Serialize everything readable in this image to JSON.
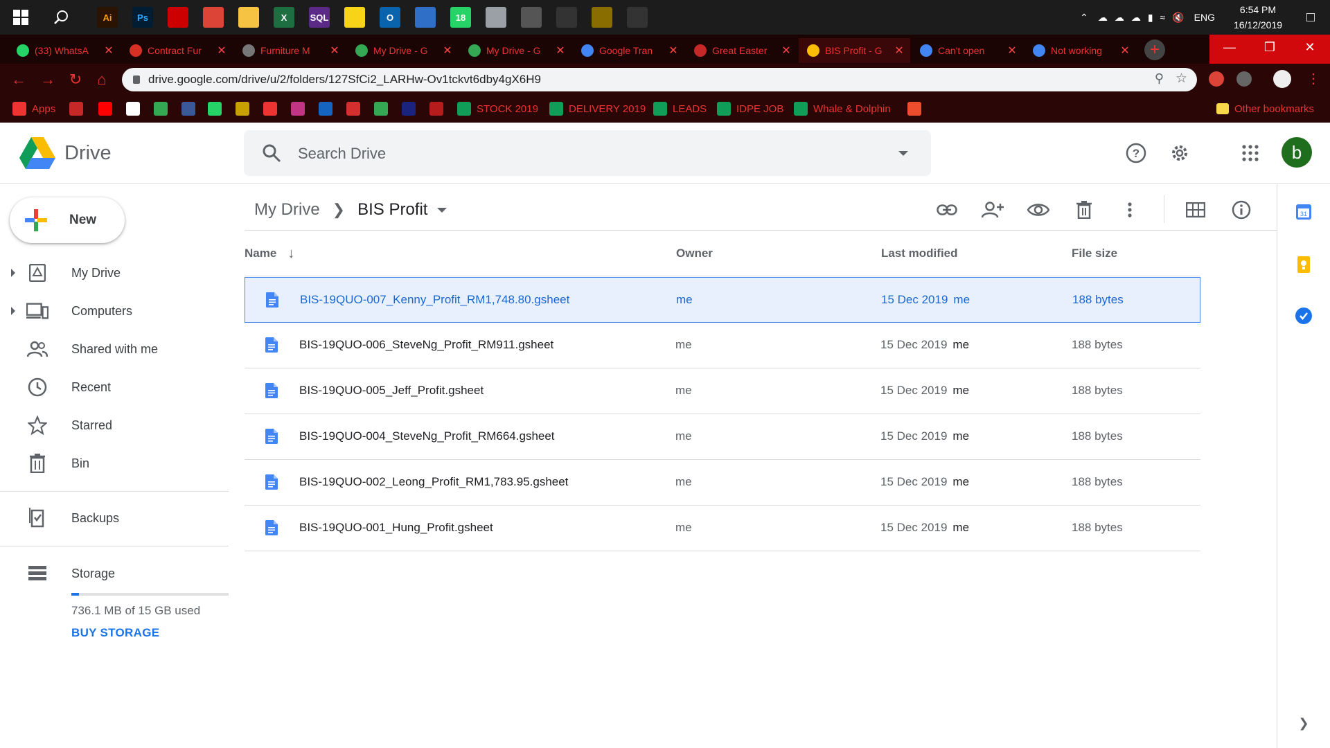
{
  "taskbar": {
    "clock_time": "6:54 PM",
    "clock_date": "16/12/2019",
    "language": "ENG",
    "apps": [
      {
        "icon": "illustrator-icon",
        "text": "Ai",
        "color": "#2a1300",
        "fg": "#ff9a00"
      },
      {
        "icon": "photoshop-icon",
        "text": "Ps",
        "color": "#001d34",
        "fg": "#31a8ff"
      },
      {
        "icon": "acrobat-icon",
        "text": "",
        "color": "#cc0000",
        "fg": "#fff"
      },
      {
        "icon": "chrome-icon",
        "text": "",
        "color": "#db4437",
        "fg": "#fff"
      },
      {
        "icon": "file-explorer-icon",
        "text": "",
        "color": "#f6c343",
        "fg": "#fff"
      },
      {
        "icon": "excel-icon",
        "text": "X",
        "color": "#1d6f42",
        "fg": "#fff"
      },
      {
        "icon": "sql-icon",
        "text": "SQL",
        "color": "#5b2a86",
        "fg": "#fff"
      },
      {
        "icon": "sticky-notes-icon",
        "text": "",
        "color": "#f7d417",
        "fg": "#fff"
      },
      {
        "icon": "outlook-icon",
        "text": "O",
        "color": "#0a64ad",
        "fg": "#fff"
      },
      {
        "icon": "network-icon",
        "text": "",
        "color": "#2f6fc8",
        "fg": "#fff"
      },
      {
        "icon": "whatsapp-icon",
        "text": "18",
        "color": "#25d366",
        "fg": "#fff"
      },
      {
        "icon": "globe-app-icon",
        "text": "",
        "color": "#9aa0a6",
        "fg": "#fff"
      },
      {
        "icon": "calculator-icon",
        "text": "",
        "color": "#555",
        "fg": "#fff"
      },
      {
        "icon": "bird-app-icon",
        "text": "",
        "color": "#333",
        "fg": "#fff"
      },
      {
        "icon": "game-icon",
        "text": "",
        "color": "#8a6d00",
        "fg": "#fff"
      },
      {
        "icon": "tree-app-icon",
        "text": "",
        "color": "#333",
        "fg": "#fff"
      }
    ]
  },
  "browser": {
    "tabs": [
      {
        "title": "(33) WhatsA",
        "fav": "#25d366",
        "icon": "whatsapp-tab-icon"
      },
      {
        "title": "Contract Fur",
        "fav": "#d93025",
        "icon": "contract-tab-icon"
      },
      {
        "title": "Furniture M",
        "fav": "#777",
        "icon": "furniture-tab-icon"
      },
      {
        "title": "My Drive - G",
        "fav": "#34a853",
        "icon": "drive-tab-icon"
      },
      {
        "title": "My Drive - G",
        "fav": "#34a853",
        "icon": "drive-tab-icon"
      },
      {
        "title": "Google Tran",
        "fav": "#4285f4",
        "icon": "translate-tab-icon"
      },
      {
        "title": "Great Easter",
        "fav": "#c62828",
        "icon": "great-eastern-tab-icon"
      },
      {
        "title": "BIS Profit - G",
        "fav": "#fbbc04",
        "icon": "drive-tab-icon"
      },
      {
        "title": "Can't open",
        "fav": "#4285f4",
        "icon": "google-tab-icon"
      },
      {
        "title": "Not working",
        "fav": "#4285f4",
        "icon": "google-tab-icon"
      }
    ],
    "url": "drive.google.com/drive/u/2/folders/127SfCi2_LARHw-Ov1tckvt6dby4gX6H9",
    "bookmarks": [
      {
        "label": "Apps",
        "color": "#e33",
        "icon": "apps-grid-icon"
      },
      {
        "label": "",
        "color": "#c62828",
        "icon": "bookmark-icon"
      },
      {
        "label": "",
        "color": "#f00",
        "icon": "youtube-icon"
      },
      {
        "label": "",
        "color": "#fff",
        "icon": "gmail-icon"
      },
      {
        "label": "",
        "color": "#34a853",
        "icon": "drive-bookmark-icon"
      },
      {
        "label": "",
        "color": "#3b5998",
        "icon": "facebook-icon"
      },
      {
        "label": "",
        "color": "#25d366",
        "icon": "whatsapp-bookmark-icon"
      },
      {
        "label": "",
        "color": "#c8a100",
        "icon": "bookmark-icon"
      },
      {
        "label": "",
        "color": "#e33",
        "icon": "bookmark-icon"
      },
      {
        "label": "",
        "color": "#c13584",
        "icon": "instagram-icon"
      },
      {
        "label": "",
        "color": "#1565c0",
        "icon": "bookmark-icon"
      },
      {
        "label": "",
        "color": "#d32f2f",
        "icon": "bookmark-icon"
      },
      {
        "label": "",
        "color": "#34a853",
        "icon": "maps-icon"
      },
      {
        "label": "",
        "color": "#1a237e",
        "icon": "bookmark-icon"
      },
      {
        "label": "",
        "color": "#b71c1c",
        "icon": "bookmark-icon"
      },
      {
        "label": "STOCK 2019",
        "color": "#0f9d58",
        "icon": "sheets-icon"
      },
      {
        "label": "DELIVERY 2019",
        "color": "#0f9d58",
        "icon": "sheets-icon"
      },
      {
        "label": "LEADS",
        "color": "#0f9d58",
        "icon": "sheets-icon"
      },
      {
        "label": "IDPE JOB",
        "color": "#0f9d58",
        "icon": "sheets-icon"
      },
      {
        "label": "Whale & Dolphin",
        "color": "#0f9d58",
        "icon": "sheets-icon"
      },
      {
        "label": "",
        "color": "#ee4d2d",
        "icon": "shopee-icon"
      }
    ],
    "other_bookmarks": "Other bookmarks"
  },
  "drive": {
    "logo_text": "Drive",
    "search_placeholder": "Search Drive",
    "avatar_letter": "b",
    "new_label": "New",
    "nav": {
      "my_drive": "My Drive",
      "computers": "Computers",
      "shared": "Shared with me",
      "recent": "Recent",
      "starred": "Starred",
      "bin": "Bin",
      "backups": "Backups",
      "storage": "Storage"
    },
    "storage": {
      "used_text": "736.1 MB of 15 GB used",
      "used_fraction": 0.049,
      "buy_label": "BUY STORAGE"
    },
    "breadcrumb": {
      "root": "My Drive",
      "current": "BIS Profit"
    },
    "columns": {
      "name": "Name",
      "owner": "Owner",
      "modified": "Last modified",
      "size": "File size"
    },
    "files": [
      {
        "name": "BIS-19QUO-007_Kenny_Profit_RM1,748.80.gsheet",
        "owner": "me",
        "modified": "15 Dec 2019",
        "modified_by": "me",
        "size": "188 bytes"
      },
      {
        "name": "BIS-19QUO-006_SteveNg_Profit_RM911.gsheet",
        "owner": "me",
        "modified": "15 Dec 2019",
        "modified_by": "me",
        "size": "188 bytes"
      },
      {
        "name": "BIS-19QUO-005_Jeff_Profit.gsheet",
        "owner": "me",
        "modified": "15 Dec 2019",
        "modified_by": "me",
        "size": "188 bytes"
      },
      {
        "name": "BIS-19QUO-004_SteveNg_Profit_RM664.gsheet",
        "owner": "me",
        "modified": "15 Dec 2019",
        "modified_by": "me",
        "size": "188 bytes"
      },
      {
        "name": "BIS-19QUO-002_Leong_Profit_RM1,783.95.gsheet",
        "owner": "me",
        "modified": "15 Dec 2019",
        "modified_by": "me",
        "size": "188 bytes"
      },
      {
        "name": "BIS-19QUO-001_Hung_Profit.gsheet",
        "owner": "me",
        "modified": "15 Dec 2019",
        "modified_by": "me",
        "size": "188 bytes"
      }
    ],
    "colors": {
      "accent": "#1a73e8",
      "selected_row": "#e8f0fe",
      "avatar": "#1e6e1e"
    }
  }
}
